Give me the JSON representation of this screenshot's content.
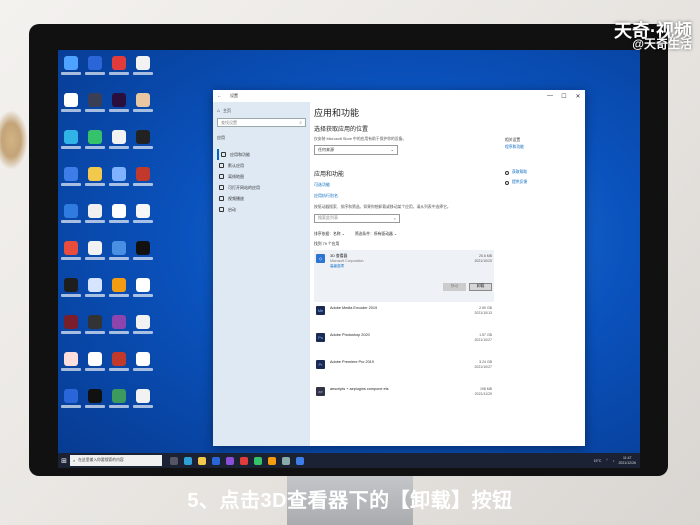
{
  "watermark": {
    "main": "天奇·视频",
    "sub": "@天奇生活"
  },
  "window": {
    "title": "设置",
    "controls": [
      "—",
      "☐",
      "✕"
    ]
  },
  "sidebar": {
    "home": "主页",
    "search_placeholder": "查找设置",
    "section": "应用",
    "items": [
      {
        "label": "应用和功能"
      },
      {
        "label": "默认应用"
      },
      {
        "label": "离线地图"
      },
      {
        "label": "可打开网站的应用"
      },
      {
        "label": "视频播放"
      },
      {
        "label": "启动"
      }
    ]
  },
  "main": {
    "page_title": "应用和功能",
    "source_heading": "选择获取应用的位置",
    "source_desc": "仅安装 Microsoft Store 中的应用有助于保护你的设备。",
    "source_value": "任何来源",
    "apps_heading": "应用和功能",
    "optional_link": "可选功能",
    "alias_link": "应用执行别名",
    "search_desc": "按驱动器搜索、排序和筛选。如果你想卸载或移动某个应用，请从列表中选择它。",
    "search_placeholder": "搜索此列表",
    "sort_label": "排序依据：",
    "sort_value": "名称",
    "filter_label": "筛选条件：",
    "filter_value": "所有驱动器",
    "count": "找到 79 个应用",
    "apps": [
      {
        "name": "3D 查看器",
        "publisher": "Microsoft Corporation",
        "link": "高级选项",
        "size": "25.6 MB",
        "date": "2021/10/20",
        "selected": true
      },
      {
        "name": "Adobe Media Encoder 2019",
        "size": "2.69 GB",
        "date": "2021/10/13"
      },
      {
        "name": "Adobe Photoshop 2020",
        "size": "1.57 GB",
        "date": "2021/10/27"
      },
      {
        "name": "Adobe Premiere Pro 2019",
        "size": "3.24 GB",
        "date": "2021/10/27"
      },
      {
        "name": "aescripts + aeplugins compone ets",
        "size": "198 MB",
        "date": "2021/11/29"
      }
    ],
    "move_button": "移动",
    "uninstall_button": "卸载"
  },
  "related": {
    "title": "相关设置",
    "link": "程序和功能",
    "help": "获取帮助",
    "feedback": "提供反馈"
  },
  "taskbar": {
    "search_placeholder": "在这里输入你要搜索的内容",
    "temperature": "19°C",
    "time": "11:47",
    "date": "2021/12/26"
  },
  "caption": "5、点击3D查看器下的【卸载】按钮",
  "colors": {
    "desktop": "#0a52bd",
    "accent": "#0067c0",
    "taskbar": "#1b2233"
  }
}
